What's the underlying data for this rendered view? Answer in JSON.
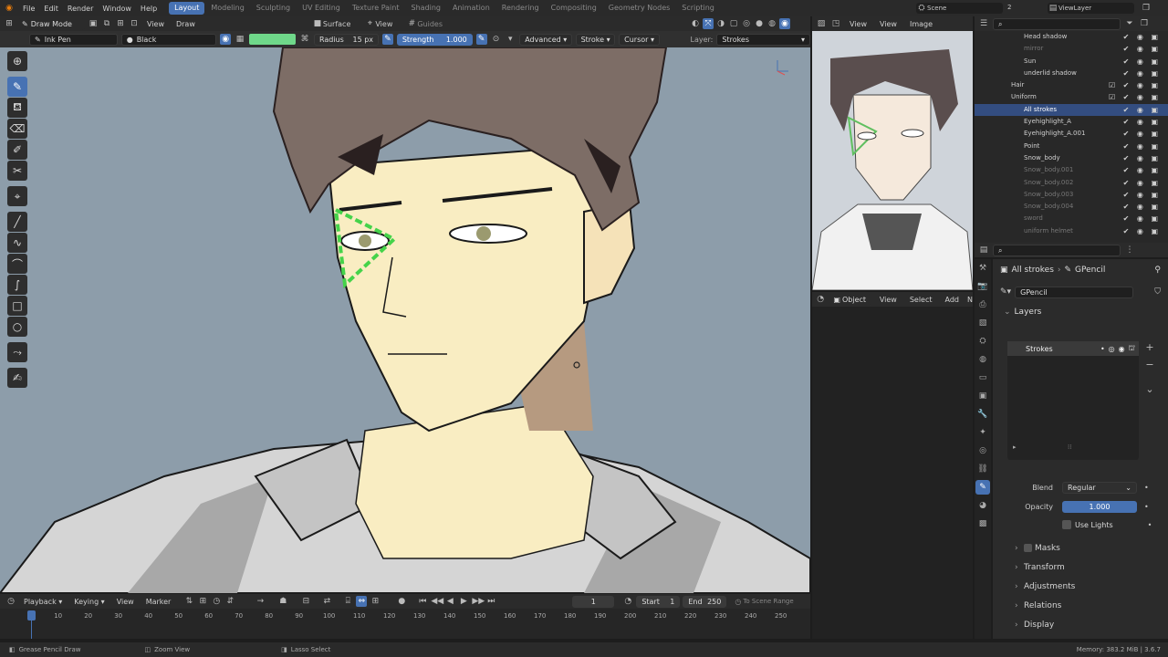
{
  "menus": [
    "File",
    "Edit",
    "Render",
    "Window",
    "Help"
  ],
  "workspaces": [
    "Layout",
    "Modeling",
    "Sculpting",
    "UV Editing",
    "Texture Paint",
    "Shading",
    "Animation",
    "Rendering",
    "Compositing",
    "Geometry Nodes",
    "Scripting"
  ],
  "active_workspace": "Layout",
  "topbar": {
    "scene": "Scene",
    "scene_count": "2",
    "view_layer": "ViewLayer"
  },
  "header": {
    "mode": "Draw Mode",
    "view": "View",
    "draw": "Draw",
    "surface": "Surface",
    "view2": "View",
    "guides": "Guides"
  },
  "toolsettings": {
    "brush": "Ink Pen",
    "material": "Black",
    "radius_label": "Radius",
    "radius_value": "15 px",
    "strength_label": "Strength",
    "strength_value": "1.000",
    "advanced": "Advanced",
    "stroke": "Stroke",
    "cursor": "Cursor",
    "layer_label": "Layer:",
    "layer_value": "Strokes",
    "color_swatch": "#6fd88a"
  },
  "image_editor": {
    "view": "View",
    "view2": "View",
    "image": "Image"
  },
  "outliner": {
    "search_placeholder": "",
    "rows": [
      {
        "name": "Head shadow",
        "dim": false,
        "sel": false
      },
      {
        "name": "mirror",
        "dim": true,
        "sel": false
      },
      {
        "name": "Sun",
        "dim": false,
        "sel": false
      },
      {
        "name": "underlid shadow",
        "dim": false,
        "sel": false
      },
      {
        "name": "Hair",
        "dim": false,
        "sel": false
      },
      {
        "name": "Uniform",
        "dim": false,
        "sel": false
      },
      {
        "name": "All strokes",
        "dim": false,
        "sel": true
      },
      {
        "name": "Eyehighlight_A",
        "dim": false,
        "sel": false
      },
      {
        "name": "Eyehighlight_A.001",
        "dim": false,
        "sel": false
      },
      {
        "name": "Point",
        "dim": false,
        "sel": false
      },
      {
        "name": "Snow_body",
        "dim": false,
        "sel": false
      },
      {
        "name": "Snow_body.001",
        "dim": true,
        "sel": false
      },
      {
        "name": "Snow_body.002",
        "dim": true,
        "sel": false
      },
      {
        "name": "Snow_body.003",
        "dim": true,
        "sel": false
      },
      {
        "name": "Snow_body.004",
        "dim": true,
        "sel": false
      },
      {
        "name": "sword",
        "dim": true,
        "sel": false
      },
      {
        "name": "uniform helmet",
        "dim": true,
        "sel": false
      }
    ]
  },
  "bottom_left_header": {
    "object": "Object",
    "view": "View",
    "select": "Select",
    "add": "Add",
    "n": "N"
  },
  "properties": {
    "breadcrumb_object": "All strokes",
    "breadcrumb_data": "GPencil",
    "data_name": "GPencil",
    "layers_title": "Layers",
    "layer_item": "Strokes",
    "blend_label": "Blend",
    "blend_value": "Regular",
    "opacity_label": "Opacity",
    "opacity_value": "1.000",
    "use_lights": "Use Lights",
    "sections": [
      "Masks",
      "Transform",
      "Adjustments",
      "Relations",
      "Display"
    ]
  },
  "timeline": {
    "playback": "Playback",
    "keying": "Keying",
    "view": "View",
    "marker": "Marker",
    "current_frame": "1",
    "start_label": "Start",
    "start_value": "1",
    "end_label": "End",
    "end_value": "250",
    "scene_range": "To Scene Range",
    "ticks": [
      "1",
      "10",
      "20",
      "30",
      "40",
      "50",
      "60",
      "70",
      "80",
      "90",
      "100",
      "110",
      "120",
      "130",
      "140",
      "150",
      "160",
      "170",
      "180",
      "190",
      "200",
      "210",
      "220",
      "230",
      "240",
      "250"
    ]
  },
  "statusbar": {
    "left": "Grease Pencil Draw",
    "middle": "Zoom View",
    "right": "Lasso Select",
    "memory": "Memory: 383.2 MiB | 3.6.7"
  }
}
